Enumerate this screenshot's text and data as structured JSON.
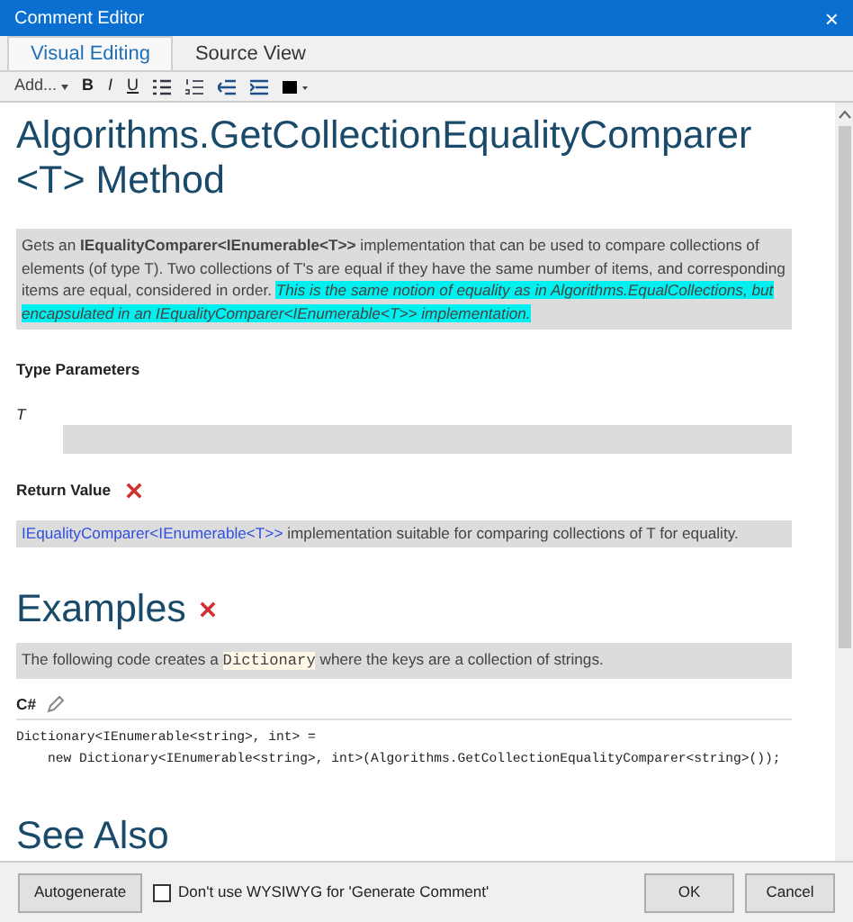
{
  "window": {
    "title": "Comment Editor",
    "close": "×"
  },
  "tabs": [
    {
      "label": "Visual Editing",
      "selected": true
    },
    {
      "label": "Source View",
      "selected": false
    }
  ],
  "toolbar": {
    "add": "Add...",
    "bold": "B",
    "italic": "I",
    "underline": "U"
  },
  "title": "Algorithms.GetCollectionEqualityComparer <T> Method",
  "summary": [
    {
      "kind": "plain",
      "text": "Gets an **IEqualityComparer<IEnumerable<T>>** implementation that can be used to compare collections of elements (of type T). Two collections of T's are equal if they have the same number of items, and corresponding items are equal, considered in order. "
    },
    {
      "kind": "highlight",
      "text": "This is the same notion of equality as in Algorithms.EqualCollections, but encapsulated in an IEqualityComparer<IEnumerable<T>> implementation."
    }
  ],
  "type_parameters": {
    "heading": "Type Parameters",
    "items": [
      {
        "name": "T"
      }
    ]
  },
  "return_value": {
    "heading": "Return Value",
    "parts": [
      {
        "kind": "link",
        "text": "IEqualityComparer<IEnumerable<T>>"
      },
      {
        "kind": "plain",
        "text": " implementation suitable for comparing collections of T for equality."
      }
    ]
  },
  "examples": {
    "heading": "Examples",
    "parts": [
      {
        "kind": "plain",
        "text": "The following code creates a "
      },
      {
        "kind": "code",
        "text": "Dictionary"
      },
      {
        "kind": "plain",
        "text": " where the keys are a collection of strings."
      }
    ],
    "language": "C#",
    "code": [
      "Dictionary<IEnumerable<string>, int> =",
      "    new Dictionary<IEnumerable<string>, int>(Algorithms.GetCollectionEqualityComparer<string>());"
    ]
  },
  "see_also": {
    "heading": "See Also"
  },
  "footer": {
    "autogenerate": "Autogenerate",
    "checkbox": {
      "label": "Don't use WYSIWYG for 'Generate Comment'",
      "checked": false
    },
    "ok": "OK",
    "cancel": "Cancel"
  }
}
